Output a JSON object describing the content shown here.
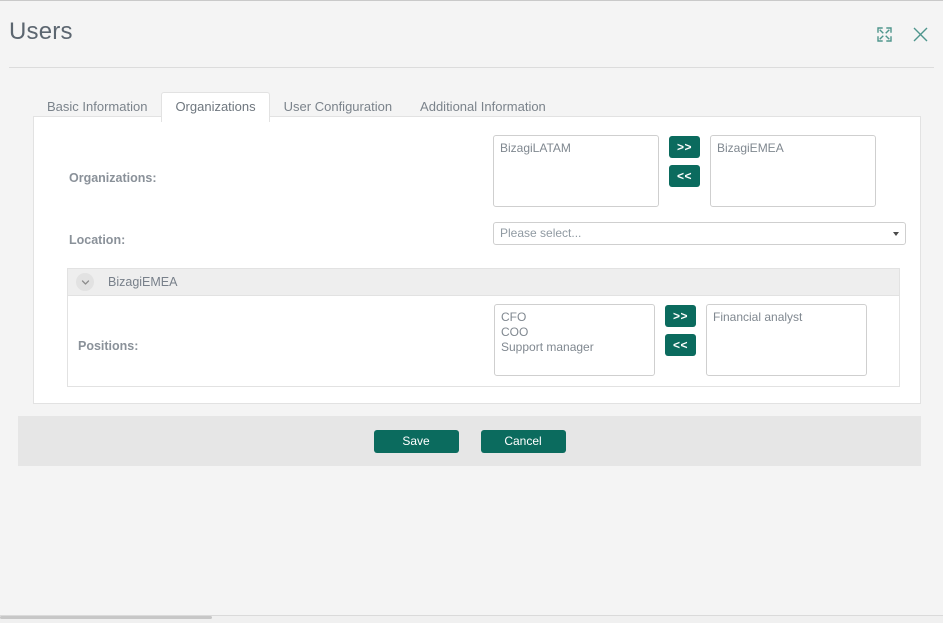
{
  "window": {
    "title": "Users",
    "expand_icon": "expand-icon",
    "close_icon": "close-icon"
  },
  "tabs": [
    {
      "label": "Basic Information",
      "active": false
    },
    {
      "label": "Organizations",
      "active": true
    },
    {
      "label": "User Configuration",
      "active": false
    },
    {
      "label": "Additional Information",
      "active": false
    }
  ],
  "form": {
    "organizations": {
      "label": "Organizations:",
      "available": [
        "BizagiLATAM"
      ],
      "selected": [
        "BizagiEMEA"
      ],
      "add_button": ">>",
      "remove_button": "<<"
    },
    "location": {
      "label": "Location:",
      "placeholder": "Please select...",
      "value": "Please select...",
      "caret_icon": "chevron-down-icon"
    },
    "org_panel": {
      "title": "BizagiEMEA",
      "collapse_icon": "chevron-down-icon",
      "positions": {
        "label": "Positions:",
        "available": [
          "CFO",
          "COO",
          "Support manager"
        ],
        "selected": [
          "Financial analyst"
        ],
        "add_button": ">>",
        "remove_button": "<<"
      }
    }
  },
  "footer": {
    "save_label": "Save",
    "cancel_label": "Cancel"
  },
  "colors": {
    "accent_teal": "#0b6b5e",
    "icon_teal": "#4e958c",
    "title_gray": "#5c6670",
    "label_gray": "#8a9199",
    "page_bg": "#f4f4f4",
    "footer_bg": "#e6e6e6"
  }
}
